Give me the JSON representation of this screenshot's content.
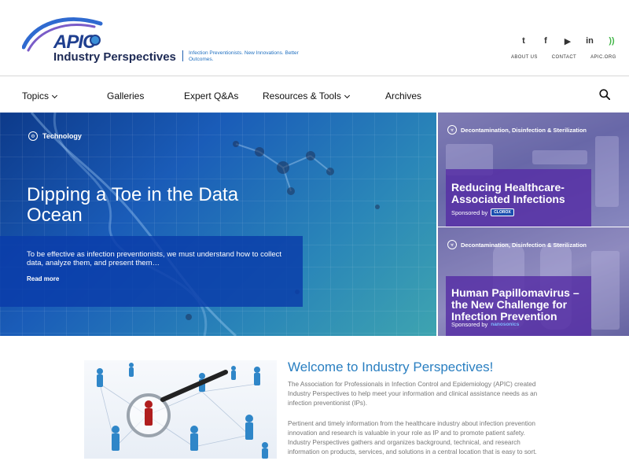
{
  "header": {
    "logo_word": "APIC",
    "brand": "Industry Perspectives",
    "tagline": "Infection Preventionists. New Innovations. Better Outcomes.",
    "social": [
      {
        "name": "twitter-icon",
        "glyph": "t"
      },
      {
        "name": "facebook-icon",
        "glyph": "f"
      },
      {
        "name": "youtube-icon",
        "glyph": "▶"
      },
      {
        "name": "linkedin-icon",
        "glyph": "in"
      },
      {
        "name": "rss-icon",
        "glyph": "))"
      }
    ],
    "links": [
      "ABOUT US",
      "CONTACT",
      "APIC.ORG"
    ]
  },
  "nav": {
    "items": [
      "Topics",
      "Galleries",
      "Expert Q&As",
      "Resources & Tools",
      "Archives"
    ]
  },
  "hero": {
    "category": "Technology",
    "title": "Dipping a Toe in the Data Ocean",
    "excerpt": "To be effective as infection preventionists, we must understand how to collect data, analyze them, and present them…",
    "read_more": "Read more"
  },
  "cards": [
    {
      "category": "Decontamination, Disinfection & Sterilization",
      "title": "Reducing Healthcare-Associated Infections",
      "sponsored_label": "Sponsored by",
      "sponsor": "CLOROX"
    },
    {
      "category": "Decontamination, Disinfection & Sterilization",
      "title": "Human Papillomavirus – the New Challenge for Infection Prevention",
      "sponsored_label": "Sponsored by",
      "sponsor": "nanosonics"
    }
  ],
  "welcome": {
    "title": "Welcome to Industry Perspectives!",
    "para1": "The Association for Professionals in Infection Control and Epidemiology (APIC) created Industry Perspectives to help meet your information and clinical assistance needs as an infection preventionist (IPs).",
    "para2": "Pertinent and timely information from the healthcare industry about infection prevention innovation and research is valuable in your role as IP and to promote patient safety. Industry Perspectives gathers and organizes background, technical, and research information on products, services, and solutions in a central location that is easy to sort."
  },
  "colors": {
    "accent_blue": "#2a7fc1",
    "brand_navy": "#1d2a55",
    "hero_panel": "#0a3caa",
    "card_box": "#552da5",
    "rss": "#43b649"
  }
}
